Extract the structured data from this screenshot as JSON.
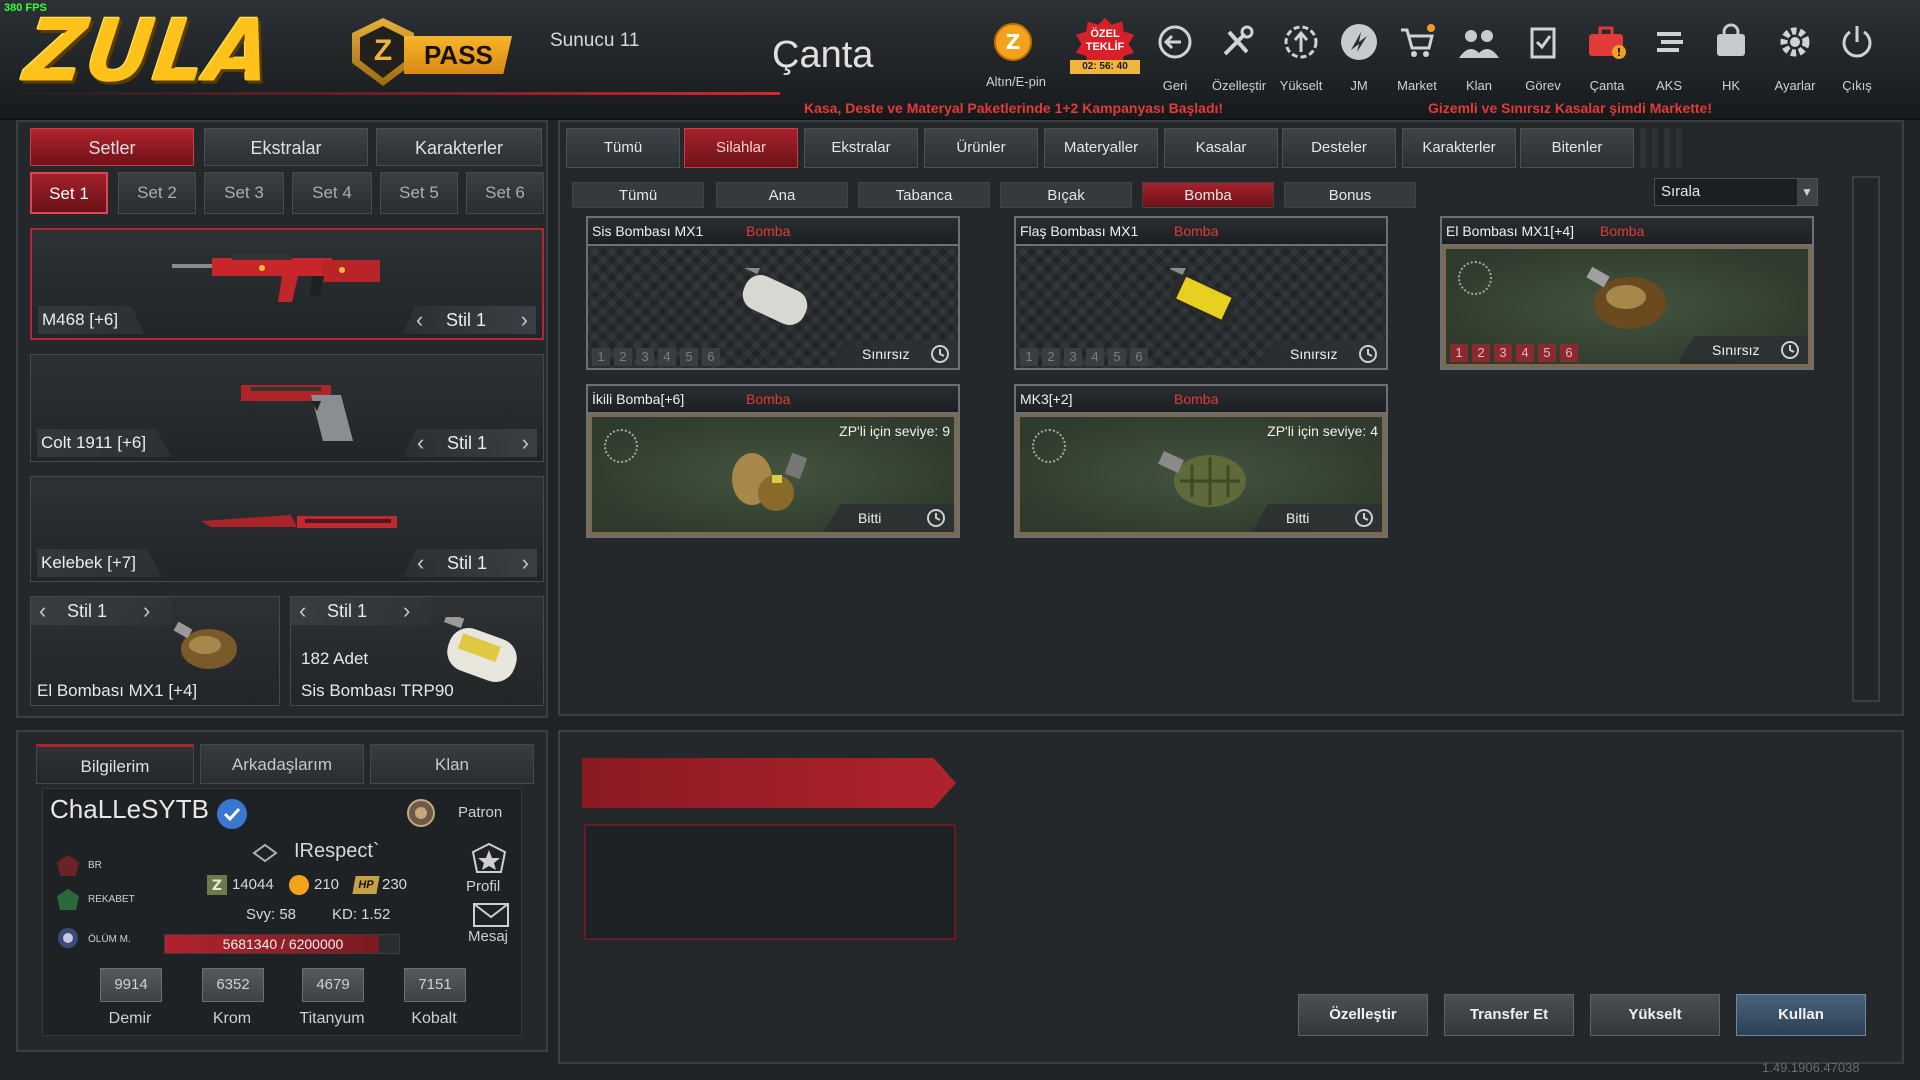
{
  "fps": "380 FPS",
  "logo": "ZULA",
  "pass": {
    "letter": "Z",
    "label": "PASS"
  },
  "server": "Sunucu 11",
  "title": "Çanta",
  "gold_label": "Altın/E-pin",
  "offer": {
    "line1": "ÖZEL",
    "line2": "TEKLİF",
    "timer": "02: 56: 40"
  },
  "nav": [
    {
      "label": "Geri",
      "icon": "back-icon"
    },
    {
      "label": "Özelleştir",
      "icon": "tools-icon"
    },
    {
      "label": "Yükselt",
      "icon": "upgrade-icon"
    },
    {
      "label": "JM",
      "icon": "jm-icon"
    },
    {
      "label": "Market",
      "icon": "cart-icon"
    },
    {
      "label": "Klan",
      "icon": "clan-icon"
    },
    {
      "label": "Görev",
      "icon": "clipboard-icon"
    },
    {
      "label": "Çanta",
      "icon": "bag-icon"
    },
    {
      "label": "AKS",
      "icon": "aks-icon"
    },
    {
      "label": "HK",
      "icon": "wallet-icon"
    },
    {
      "label": "Ayarlar",
      "icon": "gear-icon"
    },
    {
      "label": "Çıkış",
      "icon": "power-icon"
    }
  ],
  "announcements": {
    "left": "Kasa, Deste ve Materyal Paketlerinde 1+2 Kampanyası Başladı!",
    "right": "Gizemli ve Sınırsız Kasalar şimdi Markette!"
  },
  "loadout": {
    "tabs": [
      "Setler",
      "Ekstralar",
      "Karakterler"
    ],
    "sets": [
      "Set 1",
      "Set 2",
      "Set 3",
      "Set 4",
      "Set 5",
      "Set 6"
    ],
    "slots": [
      {
        "name": "M468 [+6]",
        "style": "Stil 1"
      },
      {
        "name": "Colt 1911 [+6]",
        "style": "Stil 1"
      },
      {
        "name": "Kelebek [+7]",
        "style": "Stil 1"
      }
    ],
    "grenade1": {
      "name": "El Bombası MX1 [+4]",
      "style": "Stil 1"
    },
    "grenade2": {
      "name": "Sis Bombası TRP90",
      "style": "Stil 1",
      "count": "182 Adet"
    }
  },
  "inventory": {
    "tabs": [
      "Tümü",
      "Silahlar",
      "Ekstralar",
      "Ürünler",
      "Materyaller",
      "Kasalar",
      "Desteler",
      "Karakterler",
      "Bitenler"
    ],
    "subtabs": [
      "Tümü",
      "Ana",
      "Tabanca",
      "Bıçak",
      "Bomba",
      "Bonus"
    ],
    "sort_label": "Sırala",
    "levels": [
      "1",
      "2",
      "3",
      "4",
      "5",
      "6"
    ],
    "items": [
      {
        "name": "Sis Bombası MX1",
        "category": "Bomba",
        "status": "Sınırsız"
      },
      {
        "name": "Flaş Bombası MX1",
        "category": "Bomba",
        "status": "Sınırsız"
      },
      {
        "name": "El Bombası MX1[+4]",
        "category": "Bomba",
        "status": "Sınırsız"
      },
      {
        "name": "İkili Bomba[+6]",
        "category": "Bomba",
        "status": "Bitti",
        "zp": "ZP'li için seviye: 9"
      },
      {
        "name": "MK3[+2]",
        "category": "Bomba",
        "status": "Bitti",
        "zp": "ZP'li için seviye: 4"
      }
    ]
  },
  "profile": {
    "tabs": [
      "Bilgilerim",
      "Arkadaşlarım",
      "Klan"
    ],
    "username": "ChaLLeSYTB",
    "rank": "Patron",
    "clan": "IRespect`",
    "stats": {
      "br": "BR",
      "rekabet": "REKABET",
      "olum": "ÖLÜM M."
    },
    "zp": "14044",
    "gold": "210",
    "hp_label": "HP",
    "hp": "230",
    "level": "Svy: 58",
    "kd": "KD: 1.52",
    "xp": "5681340 / 6200000",
    "xp_ratio": 0.916,
    "profile_label": "Profil",
    "mail_label": "Mesaj",
    "resources": [
      {
        "value": "9914",
        "label": "Demir"
      },
      {
        "value": "6352",
        "label": "Krom"
      },
      {
        "value": "4679",
        "label": "Titanyum"
      },
      {
        "value": "7151",
        "label": "Kobalt"
      }
    ]
  },
  "actions": [
    "Özelleştir",
    "Transfer Et",
    "Yükselt",
    "Kullan"
  ],
  "version": "1.49.1906.47038",
  "colors": {
    "accent_red": "#b0232e",
    "gold": "#ffc21a",
    "announcement": "#e23a3a"
  }
}
